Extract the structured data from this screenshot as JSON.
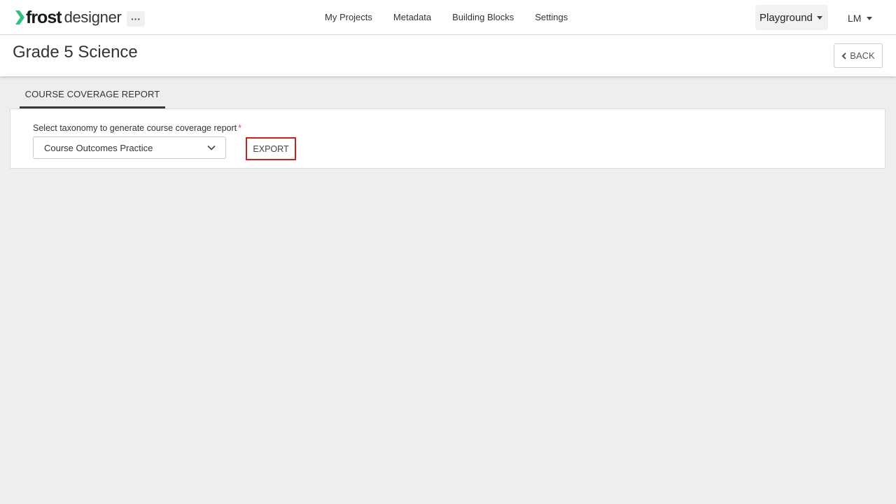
{
  "header": {
    "logo_bold": "frost",
    "logo_light": "designer",
    "more_label": "···",
    "nav": [
      {
        "label": "My Projects"
      },
      {
        "label": "Metadata"
      },
      {
        "label": "Building Blocks"
      },
      {
        "label": "Settings"
      }
    ],
    "workspace": "Playground",
    "user_initials": "LM"
  },
  "page": {
    "title": "Grade 5 Science",
    "back_label": "BACK"
  },
  "tabs": [
    {
      "label": "COURSE COVERAGE REPORT",
      "active": true
    }
  ],
  "report": {
    "label": "Select taxonomy to generate course coverage report",
    "required_mark": "*",
    "selected_taxonomy": "Course Outcomes Practice",
    "export_label": "EXPORT"
  },
  "icons": {
    "logo": "chevron-right-icon",
    "select": "chevron-down-icon",
    "back": "chevron-left-icon"
  },
  "colors": {
    "brand_accent": "#2ec27e",
    "highlight_border": "#cc1f1f",
    "tab_underline": "#333a40",
    "page_background": "#eeeeee"
  }
}
